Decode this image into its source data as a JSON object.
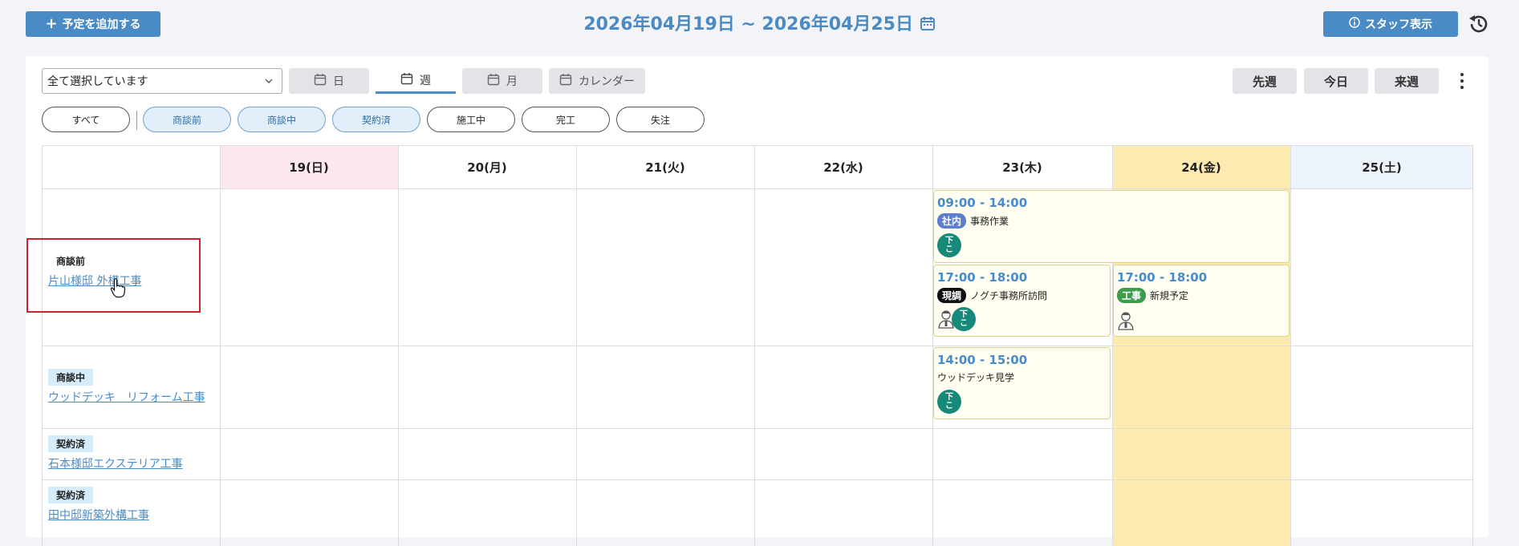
{
  "header": {
    "add_label": "予定を追加する",
    "range": "2026年04月19日 ~ 2026年04月25日",
    "staff_label": "スタッフ表示"
  },
  "toolbar": {
    "select_value": "全て選択しています",
    "tabs": [
      {
        "label": "日"
      },
      {
        "label": "週"
      },
      {
        "label": "月"
      },
      {
        "label": "カレンダー"
      }
    ],
    "nav": {
      "prev": "先週",
      "today": "今日",
      "next": "来週"
    }
  },
  "filters": [
    "すべて",
    "商談前",
    "商談中",
    "契約済",
    "施工中",
    "完工",
    "失注"
  ],
  "days": [
    "19(日)",
    "20(月)",
    "21(火)",
    "22(水)",
    "23(木)",
    "24(金)",
    "25(土)"
  ],
  "rows": [
    {
      "status": "商談前",
      "project": "片山様邸 外構工事"
    },
    {
      "status": "商談中",
      "project": "ウッドデッキ　リフォーム工事"
    },
    {
      "status": "契約済",
      "project": "石本様邸エクステリア工事"
    },
    {
      "status": "契約済",
      "project": "田中邸新築外構工事"
    }
  ],
  "events": [
    {
      "time": "09:00 - 14:00",
      "tag": "社内",
      "title": "事務作業",
      "avatar": "下こ"
    },
    {
      "time": "17:00 - 18:00",
      "tag": "現調",
      "title": "ノグチ事務所訪問",
      "avatar": "下こ"
    },
    {
      "time": "17:00 - 18:00",
      "tag": "工事",
      "title": "新規予定"
    },
    {
      "time": "14:00 - 15:00",
      "title": "ウッドデッキ見学",
      "avatar": "下こ"
    }
  ],
  "colors": {
    "accent": "#4a8bc6",
    "sunday_header": "#fce7ec",
    "today_column": "#fdeab0",
    "saturday_header": "#ecf3fb",
    "tag_internal": "#5b7ed0",
    "tag_survey": "#111111",
    "tag_construction": "#3d9c4b",
    "avatar_green": "#17897a",
    "highlight": "#d0202a"
  }
}
